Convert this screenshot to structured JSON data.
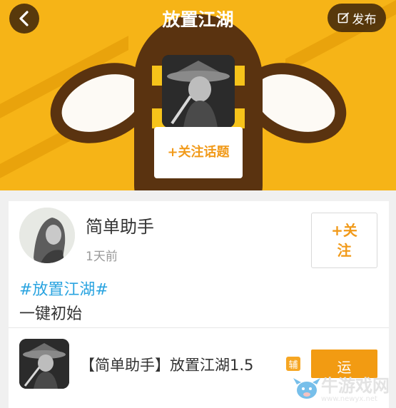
{
  "header": {
    "back_icon": "chevron-left-icon",
    "title": "放置江湖",
    "publish_label": "发布",
    "publish_icon": "edit-icon",
    "follow_topic_label": "+关注话题",
    "banner_color": "#f6b417",
    "banner_art_color": "#5a3310"
  },
  "post": {
    "author": "简单助手",
    "time": "1天前",
    "follow_label": "+关注",
    "hashtag": "#放置江湖#",
    "text": "一键初始"
  },
  "app": {
    "name": "【简单助手】放置江湖1.5",
    "badge": "辅",
    "action_label": "运",
    "accent_color": "#f29b12"
  },
  "watermark": {
    "text": "牛游戏网",
    "url": "www.newyx.net"
  }
}
